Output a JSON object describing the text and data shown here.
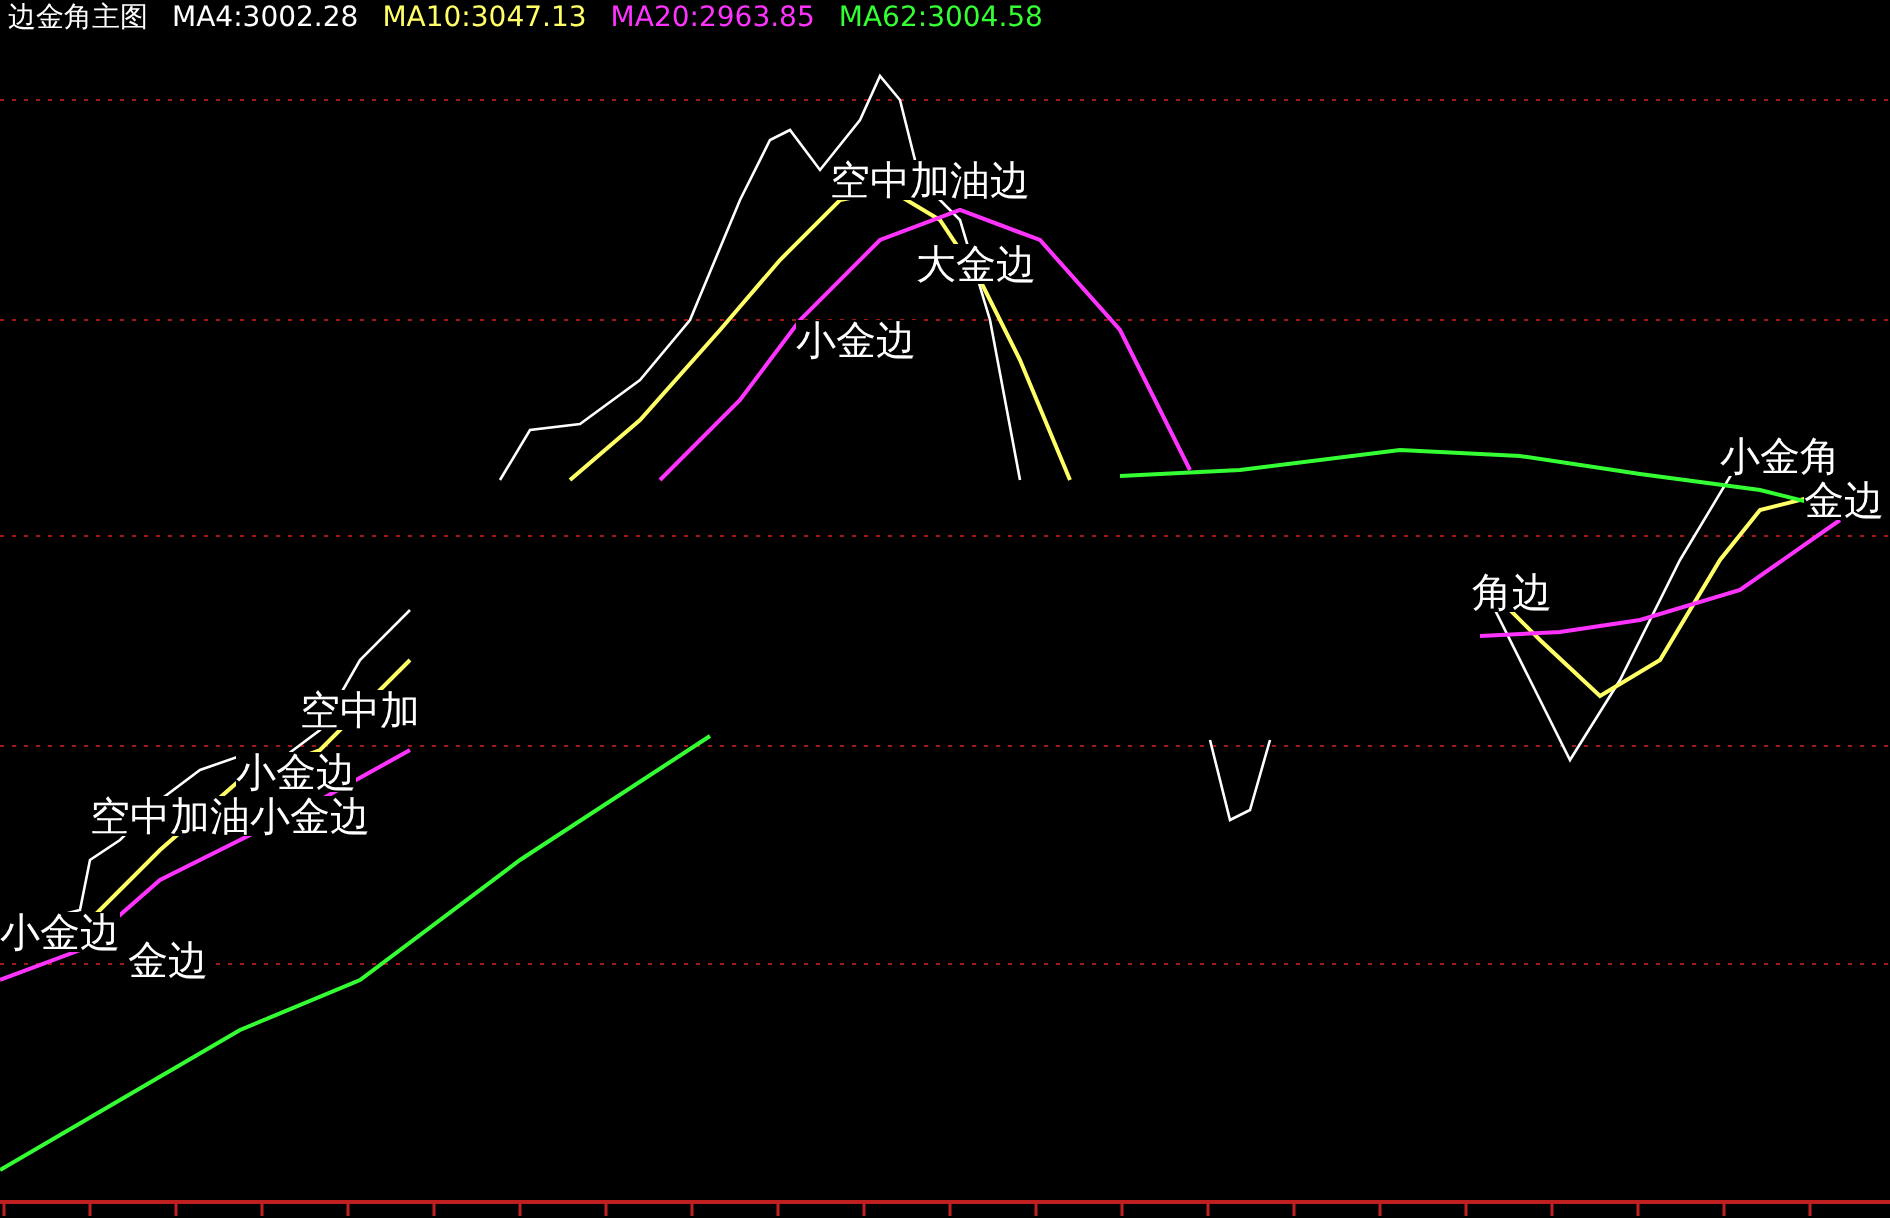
{
  "legend": {
    "title": "边金角主图",
    "items": [
      {
        "label": "MA4:3002.28",
        "color": "#ffffff"
      },
      {
        "label": "MA10:3047.13",
        "color": "#ffff66"
      },
      {
        "label": "MA20:2963.85",
        "color": "#ff33ff"
      },
      {
        "label": "MA62:3004.58",
        "color": "#33ff33"
      }
    ]
  },
  "chart": {
    "annotations": [
      {
        "text": "空中加油边"
      },
      {
        "text": "大金边"
      },
      {
        "text": "小金边"
      },
      {
        "text": "小金角"
      },
      {
        "text": "金边"
      },
      {
        "text": "角边"
      },
      {
        "text": "空中加"
      },
      {
        "text": "小金边"
      },
      {
        "text": "空中加油小金边"
      },
      {
        "text": "小金边"
      },
      {
        "text": "金边"
      }
    ]
  }
}
